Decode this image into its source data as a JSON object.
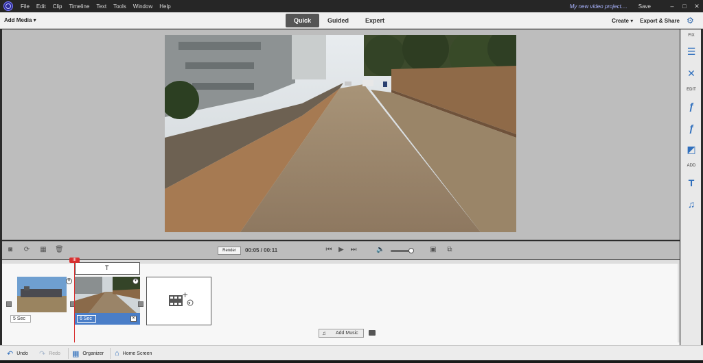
{
  "menubar": {
    "items": [
      "File",
      "Edit",
      "Clip",
      "Timeline",
      "Text",
      "Tools",
      "Window",
      "Help"
    ],
    "project_name": "My new video project....",
    "save_label": "Save",
    "minimize": "–",
    "maximize": "□",
    "close": "✕"
  },
  "toolbar": {
    "add_media": "Add Media ▾",
    "tabs": [
      "Quick",
      "Guided",
      "Expert"
    ],
    "active_tab": "Quick",
    "create": "Create ▾",
    "export_share": "Export & Share"
  },
  "right_panel": {
    "fix": "FIX",
    "edit": "EDIT",
    "add": "ADD"
  },
  "controls": {
    "render": "Render",
    "timecode": "00:05 / 00:11"
  },
  "timeline": {
    "playhead_marker": "III",
    "title_icon": "T",
    "clips": [
      {
        "duration": "5 Sec",
        "selected": false
      },
      {
        "duration": "6 Sec",
        "selected": true
      }
    ],
    "add_music": "Add Music"
  },
  "bottom": {
    "undo": "Undo",
    "redo": "Redo",
    "organizer": "Organizer",
    "home_screen": "Home Screen"
  },
  "colors": {
    "accent_blue": "#2f6fbd",
    "selected_clip": "#4a7ec8",
    "playhead": "#d83030"
  }
}
